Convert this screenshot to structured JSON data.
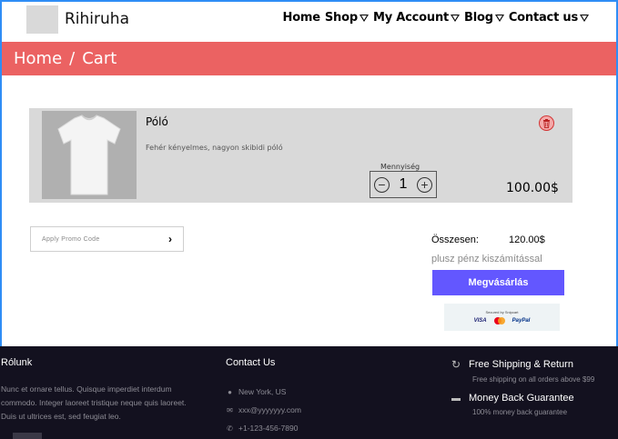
{
  "header": {
    "brand": "Rihiruha",
    "nav": [
      {
        "label": "Home",
        "dropdown": false
      },
      {
        "label": "Shop",
        "dropdown": true
      },
      {
        "label": "My Account",
        "dropdown": true
      },
      {
        "label": "Blog",
        "dropdown": true
      },
      {
        "label": "Contact us",
        "dropdown": true
      }
    ]
  },
  "breadcrumb": {
    "home": "Home",
    "separator": "/",
    "current": "Cart"
  },
  "cart": {
    "item": {
      "name": "Póló",
      "description": "Fehér kényelmes, nagyon skibidi póló",
      "quantity_label": "Mennyiség",
      "quantity": "1",
      "price": "100.00$",
      "remove_icon": "trash-icon"
    }
  },
  "promo": {
    "placeholder": "Apply Promo Code",
    "arrow": "›"
  },
  "summary": {
    "total_label": "Összesen:",
    "total_value": "120.00$",
    "shipping_note": "plusz pénz kiszámítással",
    "checkout_label": "Megvásárlás",
    "secured_text": "Secured by Snipcart",
    "payment_methods": [
      "VISA",
      "PayPal"
    ]
  },
  "footer": {
    "about": {
      "title": "Rólunk",
      "text": "Nunc et ornare tellus. Quisque imperdiet interdum commodo. Integer laoreet tristique neque quis laoreet. Duis ut ultrices est, sed feugiat leo."
    },
    "contact": {
      "title": "Contact Us",
      "address": "New York, US",
      "email": "xxx@yyyyyyy.com",
      "phone": "+1-123-456-7890"
    },
    "features": [
      {
        "icon": "refresh-icon",
        "title": "Free Shipping & Return",
        "subtitle": "Free shipping on all orders above $99"
      },
      {
        "icon": "wallet-icon",
        "title": "Money Back Guarantee",
        "subtitle": "100% money back guarantee"
      }
    ]
  },
  "colors": {
    "breadcrumb_bg": "#eb6262",
    "checkout_bg": "#6357ff",
    "footer_bg": "#13111f",
    "frame_border": "#2f8df5",
    "cart_item_bg": "#d9d9d9"
  }
}
